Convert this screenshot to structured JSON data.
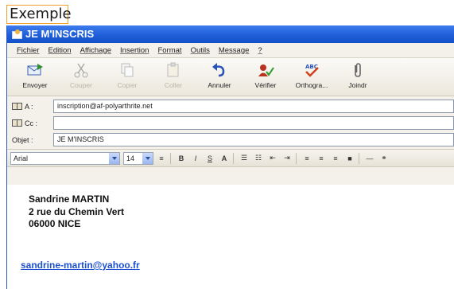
{
  "caption": "Exemple",
  "window": {
    "title": "JE M'INSCRIS"
  },
  "menu": [
    "Fichier",
    "Edition",
    "Affichage",
    "Insertion",
    "Format",
    "Outils",
    "Message",
    "?"
  ],
  "toolbar": {
    "send": "Envoyer",
    "cut": "Couper",
    "copy": "Copier",
    "paste": "Coller",
    "undo": "Annuler",
    "check": "Vérifier",
    "spelling": "Orthogra...",
    "attach": "Joindr"
  },
  "headers": {
    "to_label": "A :",
    "to_value": "inscription@af-polyarthrite.net",
    "cc_label": "Cc :",
    "cc_value": "",
    "subject_label": "Objet :",
    "subject_value": "JE M'INSCRIS"
  },
  "format": {
    "font": "Arial",
    "size": "14"
  },
  "message": {
    "line1": "Sandrine MARTIN",
    "line2": "2 rue du Chemin Vert",
    "line3": "06000 NICE",
    "email": "sandrine-martin@yahoo.fr"
  },
  "colors": {
    "titlebar": "#1f5fd8",
    "link": "#1d4fd1",
    "caption_border": "#f0a030"
  }
}
